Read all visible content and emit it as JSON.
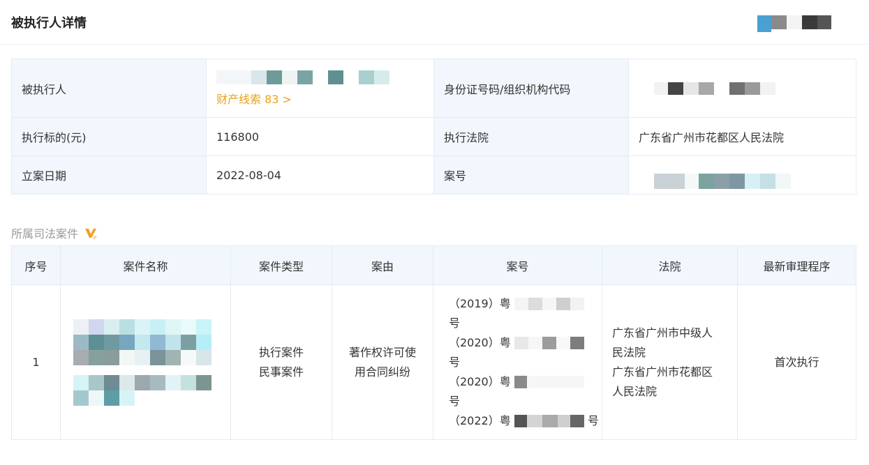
{
  "header": {
    "title": "被执行人详情"
  },
  "info": {
    "row1": {
      "label_a": "被执行人",
      "clue_link": "财产线索 83 >",
      "label_b": "身份证号码/组织机构代码"
    },
    "row2": {
      "label_a": "执行标的(元)",
      "value_a": "116800",
      "label_b": "执行法院",
      "value_b": "广东省广州市花都区人民法院"
    },
    "row3": {
      "label_a": "立案日期",
      "value_a": "2022-08-04",
      "label_b": "案号"
    }
  },
  "cases_section": {
    "title": "所属司法案件",
    "vip_icon": "vip-badge-icon"
  },
  "cases": {
    "columns": [
      "序号",
      "案件名称",
      "案件类型",
      "案由",
      "案号",
      "法院",
      "最新审理程序"
    ],
    "rows": [
      {
        "index": "1",
        "types": [
          "执行案件",
          "民事案件"
        ],
        "cause": [
          "著作权许可使",
          "用合同纠纷"
        ],
        "case_numbers": [
          "（2019）粤",
          "号",
          "（2020）粤",
          "号",
          "（2020）粤",
          "号",
          "（2022）粤",
          "号"
        ],
        "courts": [
          "广东省广州市中级人",
          "民法院",
          "广东省广州市花都区",
          "人民法院"
        ],
        "procedure": "首次执行"
      }
    ]
  },
  "colors": {
    "label_bg": "#f2f7fd",
    "border": "#e4eaf3",
    "link": "#e8a219",
    "vip": "#f0a020"
  }
}
